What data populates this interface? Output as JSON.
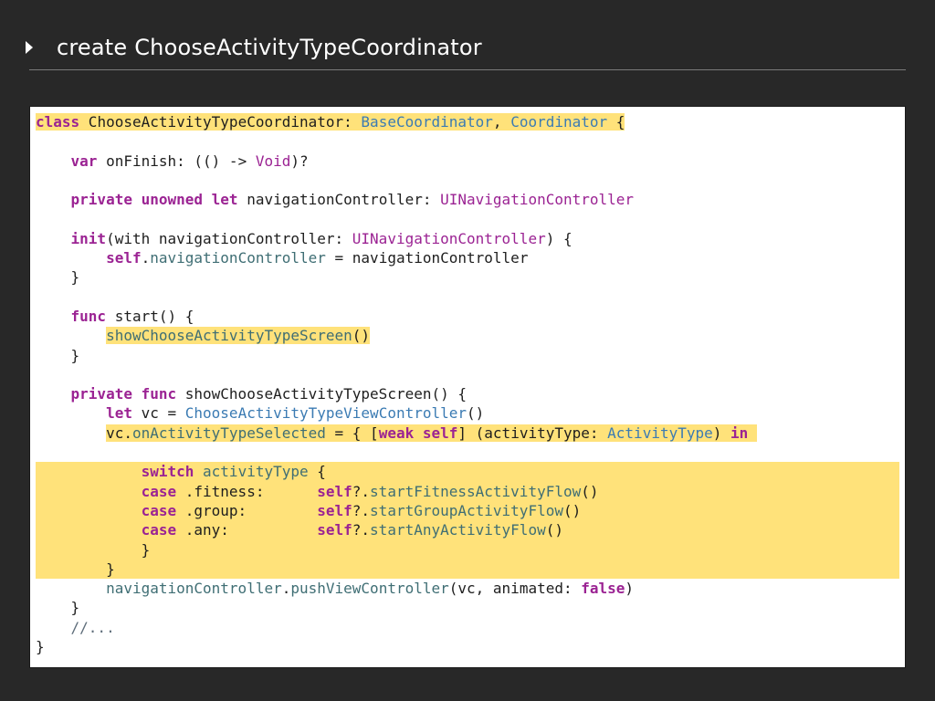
{
  "header": {
    "title": "create ChooseActivityTypeCoordinator"
  },
  "colors": {
    "background": "#282828",
    "panel": "#ffffff",
    "highlight": "#ffe27a",
    "keyword": "#9b2393",
    "type": "#3b7bb3",
    "member": "#3f6e74",
    "plain": "#1e1e1e",
    "comment": "#5d6c79"
  },
  "code": {
    "lines": [
      {
        "highlight": "none",
        "segments": [
          {
            "t": "class",
            "c": "#9b2393",
            "b": true,
            "hl": true
          },
          {
            "t": " ChooseActivityTypeCoordinator: ",
            "c": "#1e1e1e",
            "hl": true
          },
          {
            "t": "BaseCoordinator",
            "c": "#3b7bb3",
            "hl": true
          },
          {
            "t": ", ",
            "c": "#1e1e1e",
            "hl": true
          },
          {
            "t": "Coordinator",
            "c": "#3b7bb3",
            "hl": true
          },
          {
            "t": " {",
            "c": "#1e1e1e",
            "hl": true
          }
        ]
      },
      {
        "highlight": "none",
        "segments": []
      },
      {
        "highlight": "none",
        "segments": [
          {
            "t": "    ",
            "c": "#1e1e1e"
          },
          {
            "t": "var",
            "c": "#9b2393",
            "b": true
          },
          {
            "t": " onFinish: (() -> ",
            "c": "#1e1e1e"
          },
          {
            "t": "Void",
            "c": "#9b2393"
          },
          {
            "t": ")?",
            "c": "#1e1e1e"
          }
        ]
      },
      {
        "highlight": "none",
        "segments": []
      },
      {
        "highlight": "none",
        "segments": [
          {
            "t": "    ",
            "c": "#1e1e1e"
          },
          {
            "t": "private unowned let",
            "c": "#9b2393",
            "b": true
          },
          {
            "t": " navigationController: ",
            "c": "#1e1e1e"
          },
          {
            "t": "UINavigationController",
            "c": "#9b2393"
          }
        ]
      },
      {
        "highlight": "none",
        "segments": []
      },
      {
        "highlight": "none",
        "segments": [
          {
            "t": "    ",
            "c": "#1e1e1e"
          },
          {
            "t": "init",
            "c": "#9b2393",
            "b": true
          },
          {
            "t": "(with navigationController: ",
            "c": "#1e1e1e"
          },
          {
            "t": "UINavigationController",
            "c": "#9b2393"
          },
          {
            "t": ") {",
            "c": "#1e1e1e"
          }
        ]
      },
      {
        "highlight": "none",
        "segments": [
          {
            "t": "        ",
            "c": "#1e1e1e"
          },
          {
            "t": "self",
            "c": "#9b2393",
            "b": true
          },
          {
            "t": ".",
            "c": "#1e1e1e"
          },
          {
            "t": "navigationController",
            "c": "#3f6e74"
          },
          {
            "t": " = navigationController",
            "c": "#1e1e1e"
          }
        ]
      },
      {
        "highlight": "none",
        "segments": [
          {
            "t": "    }",
            "c": "#1e1e1e"
          }
        ]
      },
      {
        "highlight": "none",
        "segments": []
      },
      {
        "highlight": "none",
        "segments": [
          {
            "t": "    ",
            "c": "#1e1e1e"
          },
          {
            "t": "func",
            "c": "#9b2393",
            "b": true
          },
          {
            "t": " start() {",
            "c": "#1e1e1e"
          }
        ]
      },
      {
        "highlight": "none",
        "segments": [
          {
            "t": "        ",
            "c": "#1e1e1e"
          },
          {
            "t": "showChooseActivityTypeScreen",
            "c": "#3f6e74",
            "hl": true
          },
          {
            "t": "()",
            "c": "#1e1e1e",
            "hl": true
          }
        ]
      },
      {
        "highlight": "none",
        "segments": [
          {
            "t": "    }",
            "c": "#1e1e1e"
          }
        ]
      },
      {
        "highlight": "none",
        "segments": []
      },
      {
        "highlight": "none",
        "segments": [
          {
            "t": "    ",
            "c": "#1e1e1e"
          },
          {
            "t": "private func",
            "c": "#9b2393",
            "b": true
          },
          {
            "t": " showChooseActivityTypeScreen() {",
            "c": "#1e1e1e"
          }
        ]
      },
      {
        "highlight": "none",
        "segments": [
          {
            "t": "        ",
            "c": "#1e1e1e"
          },
          {
            "t": "let",
            "c": "#9b2393",
            "b": true
          },
          {
            "t": " vc = ",
            "c": "#1e1e1e"
          },
          {
            "t": "ChooseActivityTypeViewController",
            "c": "#3b7bb3"
          },
          {
            "t": "()",
            "c": "#1e1e1e"
          }
        ]
      },
      {
        "highlight": "none",
        "segments": [
          {
            "t": "        ",
            "c": "#1e1e1e"
          },
          {
            "t": "vc.",
            "c": "#1e1e1e",
            "hl": true
          },
          {
            "t": "onActivityTypeSelected",
            "c": "#3f6e74",
            "hl": true
          },
          {
            "t": " = { [",
            "c": "#1e1e1e",
            "hl": true
          },
          {
            "t": "weak self",
            "c": "#9b2393",
            "b": true,
            "hl": true
          },
          {
            "t": "] (activityType: ",
            "c": "#1e1e1e",
            "hl": true
          },
          {
            "t": "ActivityType",
            "c": "#3b7bb3",
            "hl": true
          },
          {
            "t": ") ",
            "c": "#1e1e1e",
            "hl": true
          },
          {
            "t": "in",
            "c": "#9b2393",
            "b": true,
            "hl": true
          },
          {
            "t": " ",
            "c": "#1e1e1e",
            "hl": true
          }
        ]
      },
      {
        "highlight": "none",
        "segments": []
      },
      {
        "highlight": "full",
        "segments": [
          {
            "t": "            ",
            "c": "#1e1e1e"
          },
          {
            "t": "switch",
            "c": "#9b2393",
            "b": true
          },
          {
            "t": " ",
            "c": "#1e1e1e"
          },
          {
            "t": "activityType",
            "c": "#3f6e74"
          },
          {
            "t": " {",
            "c": "#1e1e1e"
          }
        ]
      },
      {
        "highlight": "full",
        "segments": [
          {
            "t": "            ",
            "c": "#1e1e1e"
          },
          {
            "t": "case",
            "c": "#9b2393",
            "b": true
          },
          {
            "t": " .fitness:      ",
            "c": "#1e1e1e"
          },
          {
            "t": "self",
            "c": "#9b2393",
            "b": true
          },
          {
            "t": "?.",
            "c": "#1e1e1e"
          },
          {
            "t": "startFitnessActivityFlow",
            "c": "#3f6e74"
          },
          {
            "t": "()",
            "c": "#1e1e1e"
          }
        ]
      },
      {
        "highlight": "full",
        "segments": [
          {
            "t": "            ",
            "c": "#1e1e1e"
          },
          {
            "t": "case",
            "c": "#9b2393",
            "b": true
          },
          {
            "t": " .group:        ",
            "c": "#1e1e1e"
          },
          {
            "t": "self",
            "c": "#9b2393",
            "b": true
          },
          {
            "t": "?.",
            "c": "#1e1e1e"
          },
          {
            "t": "startGroupActivityFlow",
            "c": "#3f6e74"
          },
          {
            "t": "()",
            "c": "#1e1e1e"
          }
        ]
      },
      {
        "highlight": "full",
        "segments": [
          {
            "t": "            ",
            "c": "#1e1e1e"
          },
          {
            "t": "case",
            "c": "#9b2393",
            "b": true
          },
          {
            "t": " .any:          ",
            "c": "#1e1e1e"
          },
          {
            "t": "self",
            "c": "#9b2393",
            "b": true
          },
          {
            "t": "?.",
            "c": "#1e1e1e"
          },
          {
            "t": "startAnyActivityFlow",
            "c": "#3f6e74"
          },
          {
            "t": "()",
            "c": "#1e1e1e"
          }
        ]
      },
      {
        "highlight": "full",
        "segments": [
          {
            "t": "            }",
            "c": "#1e1e1e"
          }
        ]
      },
      {
        "highlight": "full",
        "segments": [
          {
            "t": "        }",
            "c": "#1e1e1e"
          }
        ]
      },
      {
        "highlight": "none",
        "segments": [
          {
            "t": "        ",
            "c": "#1e1e1e"
          },
          {
            "t": "navigationController",
            "c": "#3f6e74"
          },
          {
            "t": ".",
            "c": "#1e1e1e"
          },
          {
            "t": "pushViewController",
            "c": "#3f6e74"
          },
          {
            "t": "(vc, animated: ",
            "c": "#1e1e1e"
          },
          {
            "t": "false",
            "c": "#9b2393",
            "b": true
          },
          {
            "t": ")",
            "c": "#1e1e1e"
          }
        ]
      },
      {
        "highlight": "none",
        "segments": [
          {
            "t": "    }",
            "c": "#1e1e1e"
          }
        ]
      },
      {
        "highlight": "none",
        "segments": [
          {
            "t": "    ",
            "c": "#1e1e1e"
          },
          {
            "t": "//...",
            "c": "#5d6c79"
          }
        ]
      },
      {
        "highlight": "none",
        "segments": [
          {
            "t": "}",
            "c": "#1e1e1e"
          }
        ]
      }
    ]
  }
}
